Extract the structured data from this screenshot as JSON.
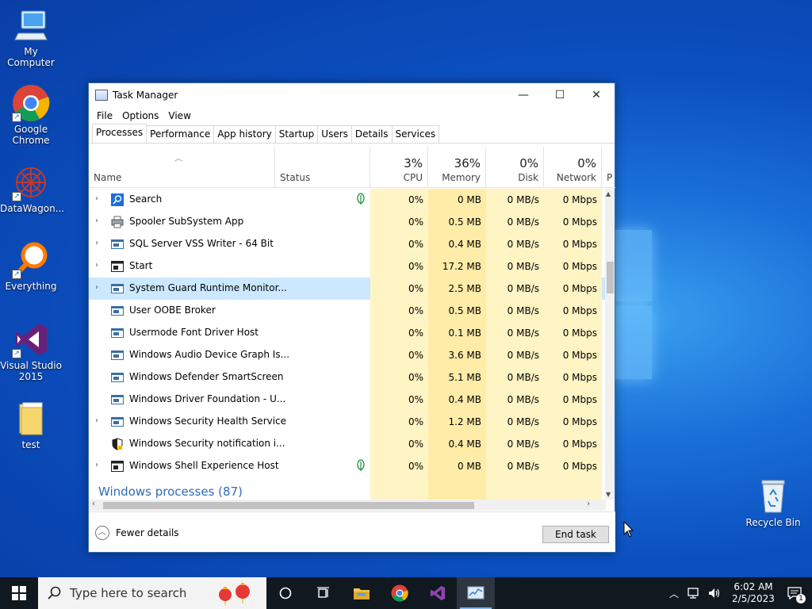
{
  "desktop": {
    "icons": [
      {
        "label": "My Computer",
        "icon": "computer-icon"
      },
      {
        "label": "Google Chrome",
        "icon": "chrome-icon"
      },
      {
        "label": "DataWagon...",
        "icon": "datawagon-icon"
      },
      {
        "label": "Everything",
        "icon": "everything-search-icon"
      },
      {
        "label": "Visual Studio 2015",
        "icon": "visual-studio-icon"
      },
      {
        "label": "test",
        "icon": "folder-icon"
      },
      {
        "label": "Recycle Bin",
        "icon": "recycle-bin-icon"
      }
    ]
  },
  "window": {
    "title": "Task Manager",
    "controls": {
      "minimize": "—",
      "maximize": "☐",
      "close": "✕"
    },
    "menu": [
      "File",
      "Options",
      "View"
    ],
    "tabs": [
      "Processes",
      "Performance",
      "App history",
      "Startup",
      "Users",
      "Details",
      "Services"
    ],
    "active_tab": "Processes",
    "columns": {
      "name": "Name",
      "status": "Status",
      "cpu": {
        "pct": "3%",
        "label": "CPU"
      },
      "memory": {
        "pct": "36%",
        "label": "Memory"
      },
      "disk": {
        "pct": "0%",
        "label": "Disk"
      },
      "network": {
        "pct": "0%",
        "label": "Network"
      },
      "power": "P"
    },
    "processes": [
      {
        "name": "Search",
        "expandable": true,
        "icon": "search-app-icon",
        "suspended": true,
        "cpu": "0%",
        "memory": "0 MB",
        "disk": "0 MB/s",
        "network": "0 Mbps"
      },
      {
        "name": "Spooler SubSystem App",
        "expandable": true,
        "icon": "printer-icon",
        "suspended": false,
        "cpu": "0%",
        "memory": "0.5 MB",
        "disk": "0 MB/s",
        "network": "0 Mbps"
      },
      {
        "name": "SQL Server VSS Writer - 64 Bit",
        "expandable": true,
        "icon": "service-window-icon",
        "suspended": false,
        "cpu": "0%",
        "memory": "0.4 MB",
        "disk": "0 MB/s",
        "network": "0 Mbps"
      },
      {
        "name": "Start",
        "expandable": true,
        "icon": "start-window-icon",
        "suspended": false,
        "cpu": "0%",
        "memory": "17.2 MB",
        "disk": "0 MB/s",
        "network": "0 Mbps"
      },
      {
        "name": "System Guard Runtime Monitor...",
        "expandable": true,
        "icon": "service-window-icon",
        "suspended": false,
        "selected": true,
        "cpu": "0%",
        "memory": "2.5 MB",
        "disk": "0 MB/s",
        "network": "0 Mbps"
      },
      {
        "name": "User OOBE Broker",
        "expandable": false,
        "icon": "service-window-icon",
        "suspended": false,
        "cpu": "0%",
        "memory": "0.5 MB",
        "disk": "0 MB/s",
        "network": "0 Mbps"
      },
      {
        "name": "Usermode Font Driver Host",
        "expandable": false,
        "icon": "service-window-icon",
        "suspended": false,
        "cpu": "0%",
        "memory": "0.1 MB",
        "disk": "0 MB/s",
        "network": "0 Mbps"
      },
      {
        "name": "Windows Audio Device Graph Is...",
        "expandable": false,
        "icon": "service-window-icon",
        "suspended": false,
        "cpu": "0%",
        "memory": "3.6 MB",
        "disk": "0 MB/s",
        "network": "0 Mbps"
      },
      {
        "name": "Windows Defender SmartScreen",
        "expandable": false,
        "icon": "service-window-icon",
        "suspended": false,
        "cpu": "0%",
        "memory": "5.1 MB",
        "disk": "0 MB/s",
        "network": "0 Mbps"
      },
      {
        "name": "Windows Driver Foundation - U...",
        "expandable": false,
        "icon": "service-window-icon",
        "suspended": false,
        "cpu": "0%",
        "memory": "0.4 MB",
        "disk": "0 MB/s",
        "network": "0 Mbps"
      },
      {
        "name": "Windows Security Health Service",
        "expandable": true,
        "icon": "service-window-icon",
        "suspended": false,
        "cpu": "0%",
        "memory": "1.2 MB",
        "disk": "0 MB/s",
        "network": "0 Mbps"
      },
      {
        "name": "Windows Security notification i...",
        "expandable": false,
        "icon": "shield-icon",
        "suspended": false,
        "cpu": "0%",
        "memory": "0.4 MB",
        "disk": "0 MB/s",
        "network": "0 Mbps"
      },
      {
        "name": "Windows Shell Experience Host",
        "expandable": true,
        "icon": "start-window-icon",
        "suspended": true,
        "cpu": "0%",
        "memory": "0 MB",
        "disk": "0 MB/s",
        "network": "0 Mbps"
      }
    ],
    "group_header": "Windows processes (87)",
    "fewer_details": "Fewer details",
    "end_task": "End task"
  },
  "taskbar": {
    "search_placeholder": "Type here to search",
    "apps": [
      "cortana-icon",
      "task-view-icon",
      "file-explorer-icon",
      "chrome-icon",
      "visual-studio-icon",
      "task-manager-icon"
    ],
    "active_app": "task-manager-icon",
    "clock": {
      "time": "6:02 AM",
      "date": "2/5/2023"
    },
    "notification_count": "1"
  },
  "colors": {
    "accent": "#0078d7",
    "selection": "#cce8ff",
    "heat_low": "#fff4c4",
    "heat_mid": "#ffeca8",
    "group_text": "#2f6bb6"
  }
}
